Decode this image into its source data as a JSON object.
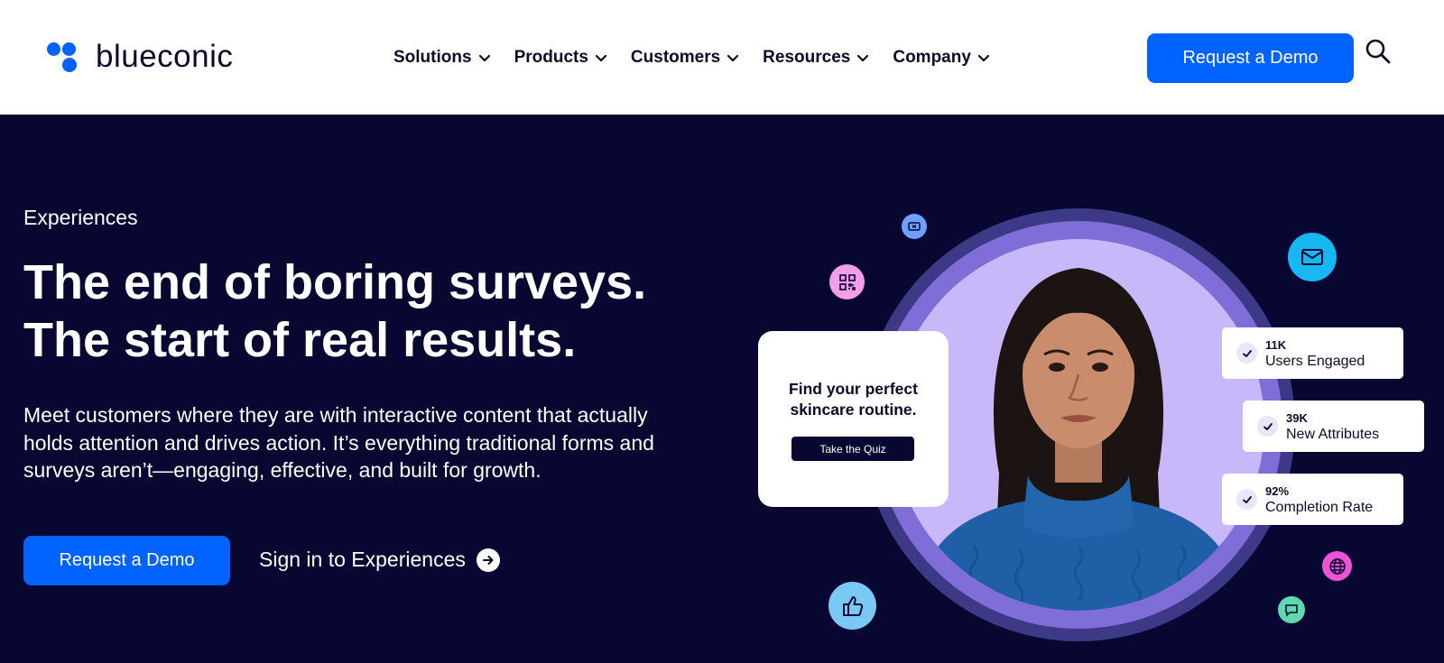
{
  "brand": {
    "name": "blueconic",
    "primary_color": "#0062ff",
    "dark_background": "#070732"
  },
  "header": {
    "nav": [
      {
        "label": "Solutions"
      },
      {
        "label": "Products"
      },
      {
        "label": "Customers"
      },
      {
        "label": "Resources"
      },
      {
        "label": "Company"
      }
    ],
    "cta_label": "Request a Demo",
    "search_icon": "search-icon"
  },
  "hero": {
    "eyebrow": "Experiences",
    "headline_line1": "The end of boring surveys.",
    "headline_line2": "The start of real results.",
    "subcopy": "Meet customers where they are with interactive content that actually holds attention and drives action. It’s everything traditional forms and surveys aren’t—engaging, effective, and built for growth.",
    "cta_label": "Request a Demo",
    "secondary_link": "Sign in to Experiences"
  },
  "illustration": {
    "quiz_card": {
      "title": "Find your perfect skincare routine.",
      "button": "Take the Quiz"
    },
    "stats": [
      {
        "value": "11K",
        "label": "Users Engaged"
      },
      {
        "value": "39K",
        "label": "New Attributes"
      },
      {
        "value": "92%",
        "label": "Completion Rate"
      }
    ],
    "bubble_icons": [
      "ticket-icon",
      "qr-code-icon",
      "mail-icon",
      "globe-icon",
      "chat-icon",
      "thumbs-up-icon"
    ]
  }
}
